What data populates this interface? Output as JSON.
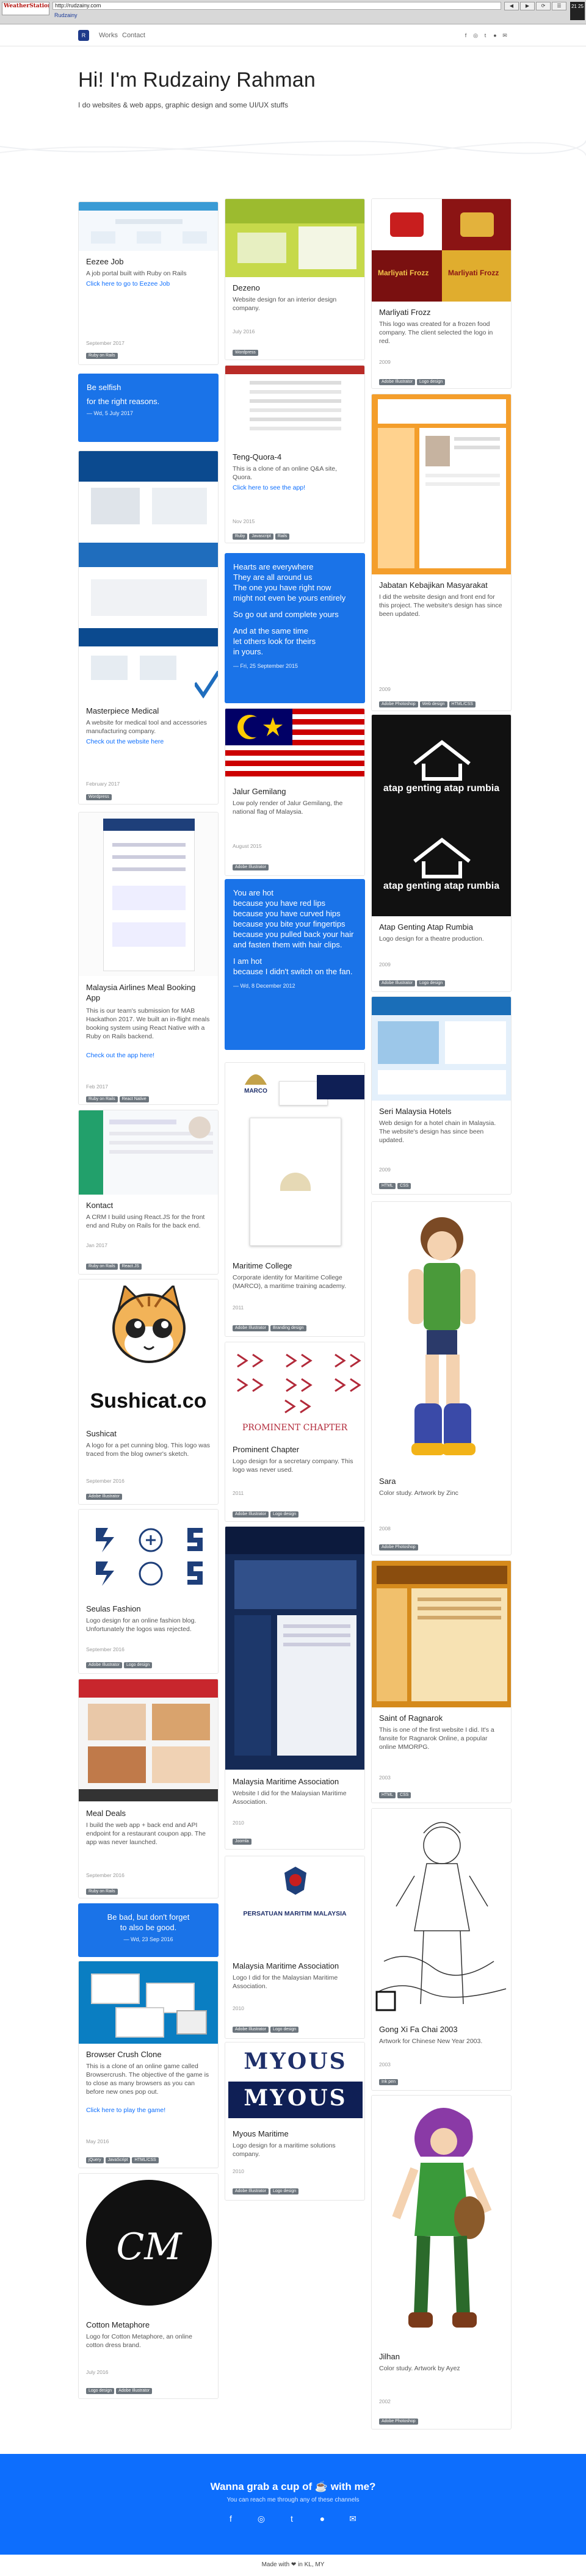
{
  "browser": {
    "logo": "WeatherStation",
    "url": "http://rudzainy.com",
    "subtitle": "Rudzainy",
    "btn_a": "◀",
    "btn_b": "▶",
    "btn_c": "⟳",
    "btn_d": "☰",
    "clock": "21 25"
  },
  "nav": {
    "brand": "R",
    "links": [
      "Works",
      "Contact"
    ]
  },
  "hero": {
    "title": "Hi! I'm Rudzainy Rahman",
    "subtitle": "I do websites & web apps, graphic design and some UI/UX stuffs"
  },
  "colors": {
    "accent": "#0d6efd",
    "quote": "#1a73e8",
    "tag": "#6c757d"
  },
  "cards": [
    {
      "title": "Eezee Job",
      "desc": "A job portal built with Ruby on Rails",
      "link": "Click here to go to Eezee Job",
      "date": "September 2017",
      "tags": [
        "Ruby on Rails"
      ]
    },
    {
      "quote": [
        "Be selfish",
        "for the right reasons."
      ],
      "qdate": "— Wd, 5 July 2017"
    },
    {
      "title": "Masterpiece Medical",
      "desc": "A website for medical tool and accessories manufacturing company.",
      "link": "Check out the website here",
      "date": "February 2017",
      "tags": [
        "Wordpress"
      ]
    },
    {
      "title": "Malaysia Airlines Meal Booking App",
      "desc": "This is our team's submission for MAB Hackathon 2017. We built an in-flight meals booking system using React Native with a Ruby on Rails backend.",
      "link": "Check out the app here!",
      "date": "Feb 2017",
      "tags": [
        "Ruby on Rails",
        "React Native"
      ]
    },
    {
      "title": "Kontact",
      "desc": "A CRM I build using React.JS for the front end and Ruby on Rails for the back end.",
      "date": "Jan 2017",
      "tags": [
        "Ruby on Rails",
        "React.JS"
      ]
    },
    {
      "title": "Sushicat",
      "desc": "A logo for a pet cunning blog. This logo was traced from the blog owner's sketch.",
      "date": "September 2016",
      "tags": [
        "Adobe Illustrator"
      ],
      "logo": "Sushicat.co"
    },
    {
      "title": "Seulas Fashion",
      "desc": "Logo design for an online fashion blog. Unfortunately the logos was rejected.",
      "date": "September 2016",
      "tags": [
        "Adobe Illustrator",
        "Logo design"
      ]
    },
    {
      "title": "Meal Deals",
      "desc": "I build the web app + back end and API endpoint for a restaurant coupon app. The app was never launched.",
      "date": "September 2016",
      "tags": [
        "Ruby on Rails"
      ]
    },
    {
      "quote": [
        "Be bad, but don't forget",
        "to also be good."
      ],
      "qdate": "— Wd, 23 Sep 2016"
    },
    {
      "title": "Browser Crush Clone",
      "desc": "This is a clone of an online game called Browsercrush. The objective of the game is to close as many browsers as you can before new ones pop out.",
      "link": "Click here to play the game!",
      "date": "May 2016",
      "tags": [
        "jQuery",
        "JavaScript",
        "HTML/CSS"
      ]
    },
    {
      "title": "Cotton Metaphore",
      "desc": "Logo for Cotton Metaphore, an online cotton dress brand.",
      "date": "July 2016",
      "tags": [
        "Logo design",
        "Adobe Illustrator"
      ],
      "logo": "CM"
    },
    {
      "title": "Dezeno",
      "desc": "Website design for an interior design company.",
      "date": "July 2016",
      "tags": [
        "Wordpress"
      ]
    },
    {
      "title": "Teng-Quora-4",
      "desc": "This is a clone of an online Q&A site, Quora.",
      "link": "Click here to see the app!",
      "date": "Nov 2015",
      "tags": [
        "Ruby",
        "Javascript",
        "Rails"
      ]
    },
    {
      "quote": [
        "Hearts are everywhere",
        "They are all around us",
        "The one you have right now",
        "might not even be yours entirely",
        "So go out and complete yours",
        "And at the same time",
        "let others look for theirs",
        "in yours."
      ],
      "qdate": "— Fri, 25 September 2015"
    },
    {
      "title": "Jalur Gemilang",
      "desc": "Low poly render of Jalur Gemilang, the national flag of Malaysia.",
      "date": "August 2015",
      "tags": [
        "Adobe Illustrator"
      ]
    },
    {
      "quote": [
        "You are hot",
        "because you have red lips",
        "because you have curved hips",
        "because you bite your fingertips",
        "because you pulled back your hair and fasten them with hair clips.",
        "I am hot",
        "because I didn't switch on the fan."
      ],
      "qdate": "— Wd, 8 December 2012"
    },
    {
      "title": "Maritime College",
      "desc": "Corporate identity for Maritime College (MARCO), a maritime training academy.",
      "date": "2011",
      "tags": [
        "Adobe Illustrator",
        "Branding design"
      ],
      "logo": "MARCO"
    },
    {
      "title": "Prominent Chapter",
      "desc": "Logo design for a secretary company. This logo was never used.",
      "date": "2011",
      "tags": [
        "Adobe Illustrator",
        "Logo design"
      ],
      "logo": "PROMINENT CHAPTER"
    },
    {
      "title": "Malaysia Maritime Association",
      "desc": "Website I did for the Malaysian Maritime Association.",
      "date": "2010",
      "tags": [
        "Joomla"
      ]
    },
    {
      "title": "Malaysia Maritime Association",
      "desc": "Logo I did for the Malaysian Maritime Association.",
      "date": "2010",
      "tags": [
        "Adobe Illustrator",
        "Logo design"
      ],
      "logo": "PERSATUAN MARITIM MALAYSIA"
    },
    {
      "title": "Myous Maritime",
      "desc": "Logo design for a maritime solutions company.",
      "date": "2010",
      "tags": [
        "Adobe Illustrator",
        "Logo design"
      ],
      "logo": "MYOUS"
    },
    {
      "title": "Marliyati Frozz",
      "desc": "This logo was created for a frozen food company. The client selected the logo in red.",
      "date": "2009",
      "tags": [
        "Adobe Illustrator",
        "Logo design"
      ],
      "logo": "Marliyati Frozz"
    },
    {
      "title": "Jabatan Kebajikan Masyarakat",
      "desc": "I did the website design and front end for this project. The website's design has since been updated.",
      "date": "2009",
      "tags": [
        "Adobe Photoshop",
        "Web design",
        "HTML/CSS"
      ]
    },
    {
      "title": "Atap Genting Atap Rumbia",
      "desc": "Logo design for a theatre production.",
      "date": "2009",
      "tags": [
        "Adobe Illustrator",
        "Logo design"
      ],
      "logo": "atap genting atap rumbia"
    },
    {
      "title": "Seri Malaysia Hotels",
      "desc": "Web design for a hotel chain in Malaysia. The website's design has since been updated.",
      "date": "2009",
      "tags": [
        "HTML",
        "CSS"
      ]
    },
    {
      "title": "Sara",
      "desc": "Color study. Artwork by Zinc",
      "date": "2008",
      "tags": [
        "Adobe Photoshop"
      ]
    },
    {
      "title": "Saint of Ragnarok",
      "desc": "This is one of the first website I did. It's a fansite for Ragnarok Online, a popular online MMORPG.",
      "date": "2003",
      "tags": [
        "HTML",
        "CSS"
      ]
    },
    {
      "title": "Gong Xi Fa Chai 2003",
      "desc": "Artwork for Chinese New Year 2003.",
      "date": "2003",
      "tags": [
        "Ink pen"
      ]
    },
    {
      "title": "Jilhan",
      "desc": "Color study. Artwork by Ayez",
      "date": "2002",
      "tags": [
        "Adobe Photoshop"
      ]
    }
  ],
  "footer": {
    "title": "Wanna grab a cup of ☕ with me?",
    "subtitle": "You can reach me through any of these channels",
    "icons": [
      "facebook-icon",
      "instagram-icon",
      "twitter-icon",
      "github-icon",
      "email-icon"
    ],
    "made": "Made with ❤ in KL, MY"
  }
}
